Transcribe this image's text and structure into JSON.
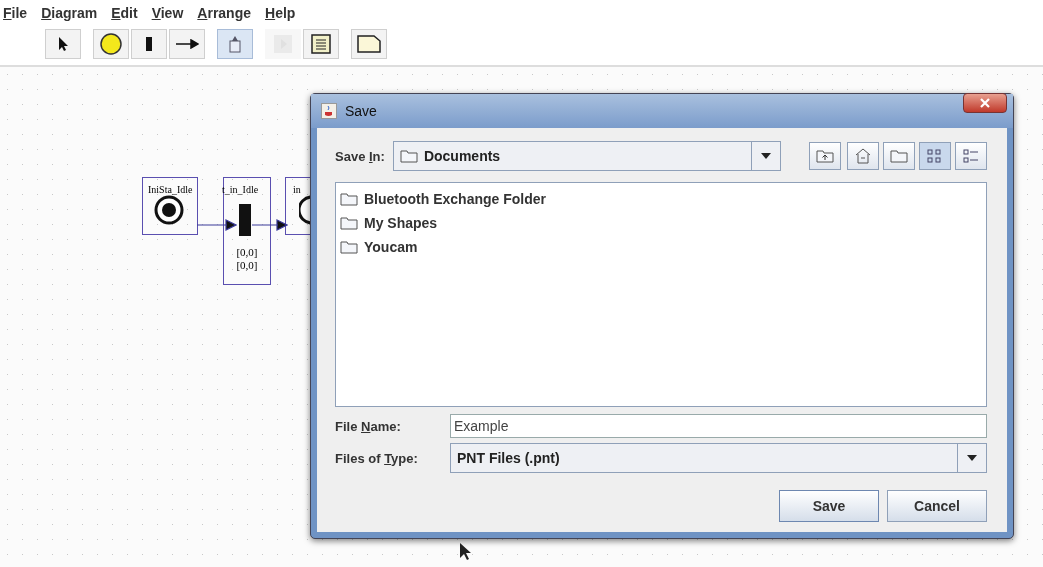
{
  "menu": [
    {
      "mnemonic": "F",
      "post": "ile"
    },
    {
      "mnemonic": "D",
      "post": "iagram"
    },
    {
      "mnemonic": "E",
      "post": "dit"
    },
    {
      "mnemonic": "V",
      "post": "iew"
    },
    {
      "mnemonic": "A",
      "post": "rrange"
    },
    {
      "mnemonic": "H",
      "post": "elp"
    }
  ],
  "toolbar": [
    [
      {
        "kind": "pointer",
        "selected": false,
        "disabled": false
      }
    ],
    [
      {
        "kind": "place",
        "selected": false,
        "disabled": false
      },
      {
        "kind": "transition",
        "selected": false,
        "disabled": false
      },
      {
        "kind": "arc",
        "selected": false,
        "disabled": false
      }
    ],
    [
      {
        "kind": "token",
        "selected": true,
        "disabled": false
      }
    ],
    [
      {
        "kind": "play",
        "selected": false,
        "disabled": true
      },
      {
        "kind": "list",
        "selected": false,
        "disabled": false
      }
    ],
    [
      {
        "kind": "note",
        "selected": false,
        "disabled": false
      }
    ]
  ],
  "diagram": {
    "nodes": [
      {
        "kind": "place",
        "label": "IniSta_Idle",
        "selected": true
      },
      {
        "kind": "transition",
        "label": "t_in_Idle",
        "selected": true,
        "marks": [
          "[0,0]",
          "[0,0]"
        ]
      },
      {
        "kind": "place",
        "label": "in",
        "selected": true
      }
    ]
  },
  "dialog": {
    "title": "Save",
    "save_in": {
      "pre": "Save ",
      "mnemonic": "I",
      "post": "n:",
      "value": "Documents"
    },
    "nav_buttons": [
      {
        "kind": "up",
        "selected": false
      },
      {
        "kind": "home",
        "selected": false
      },
      {
        "kind": "new_folder",
        "selected": false
      },
      {
        "kind": "list",
        "selected": true
      },
      {
        "kind": "details",
        "selected": false
      }
    ],
    "files": [
      {
        "name": "Bluetooth Exchange Folder",
        "selected": false
      },
      {
        "name": "My Shapes",
        "selected": false
      },
      {
        "name": "Youcam",
        "selected": false
      }
    ],
    "file_name": {
      "pre": "File ",
      "mnemonic": "N",
      "post": "ame:",
      "value": "Example"
    },
    "file_type": {
      "pre": "Files of ",
      "mnemonic": "T",
      "post": "ype:",
      "value": "PNT Files (.pnt)"
    },
    "buttons": [
      {
        "label": "Save",
        "kind": "default"
      },
      {
        "label": "Cancel",
        "kind": "normal"
      }
    ]
  }
}
